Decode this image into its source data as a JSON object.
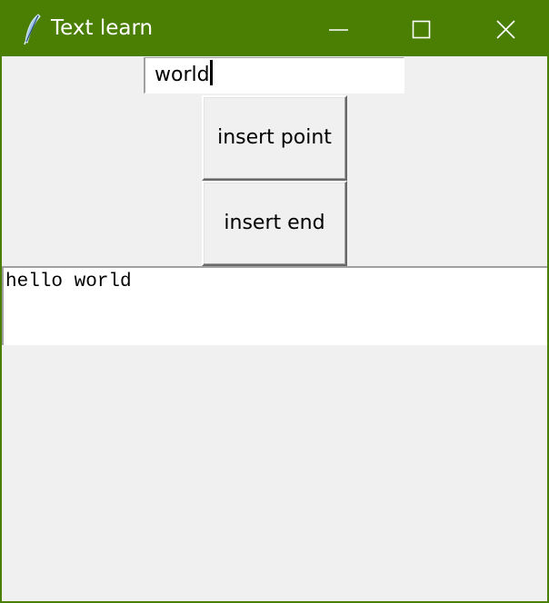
{
  "window": {
    "title": "Text learn",
    "app_icon": "feather-icon",
    "controls": {
      "minimize_icon": "minimize-icon",
      "maximize_icon": "maximize-icon",
      "close_icon": "close-icon"
    },
    "title_bar_color": "#4a7f03"
  },
  "entry": {
    "value": "world"
  },
  "buttons": {
    "insert_point_label": "insert point",
    "insert_end_label": "insert end"
  },
  "text_widget": {
    "content": "hello world"
  }
}
